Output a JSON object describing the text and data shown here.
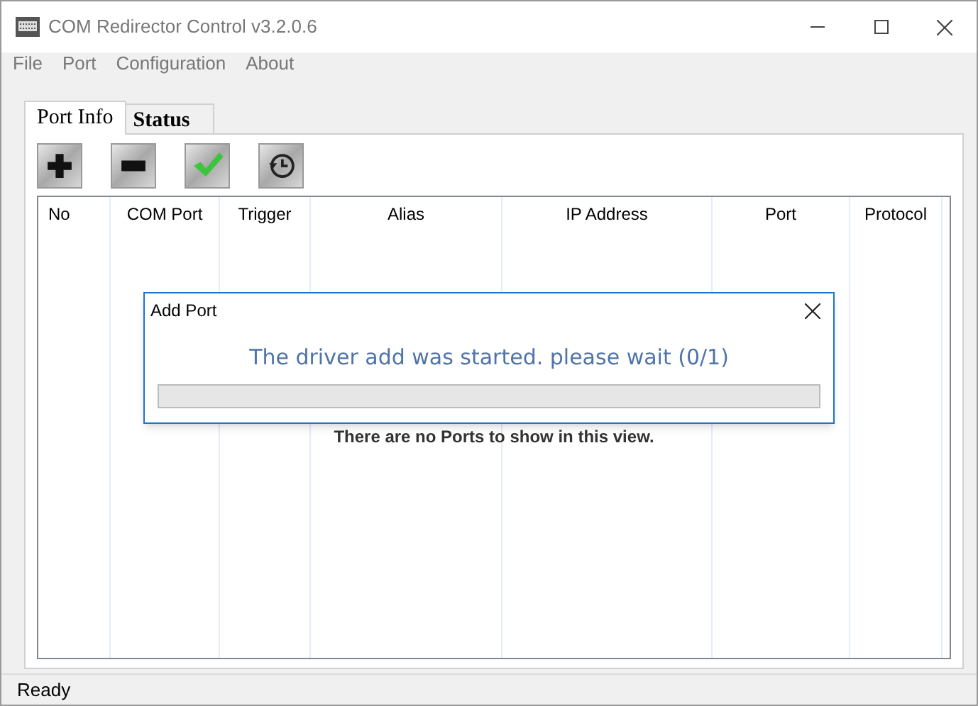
{
  "window": {
    "title": "COM Redirector Control v3.2.0.6"
  },
  "menu": [
    "File",
    "Port",
    "Configuration",
    "About"
  ],
  "tabs": [
    {
      "label": "Port Info",
      "selected": true
    },
    {
      "label": "Status",
      "selected": false
    }
  ],
  "toolbar": [
    {
      "kind": "add"
    },
    {
      "kind": "remove"
    },
    {
      "kind": "apply"
    },
    {
      "kind": "history"
    }
  ],
  "table": {
    "columns": [
      "No",
      "COM Port",
      "Trigger",
      "Alias",
      "IP Address",
      "Port",
      "Protocol"
    ],
    "empty_message": "There are no Ports to show in this view."
  },
  "dialog": {
    "title": "Add Port",
    "message": "The driver add was started. please wait (0/1)",
    "progress": {
      "level": 0
    }
  },
  "status_bar": "Ready"
}
